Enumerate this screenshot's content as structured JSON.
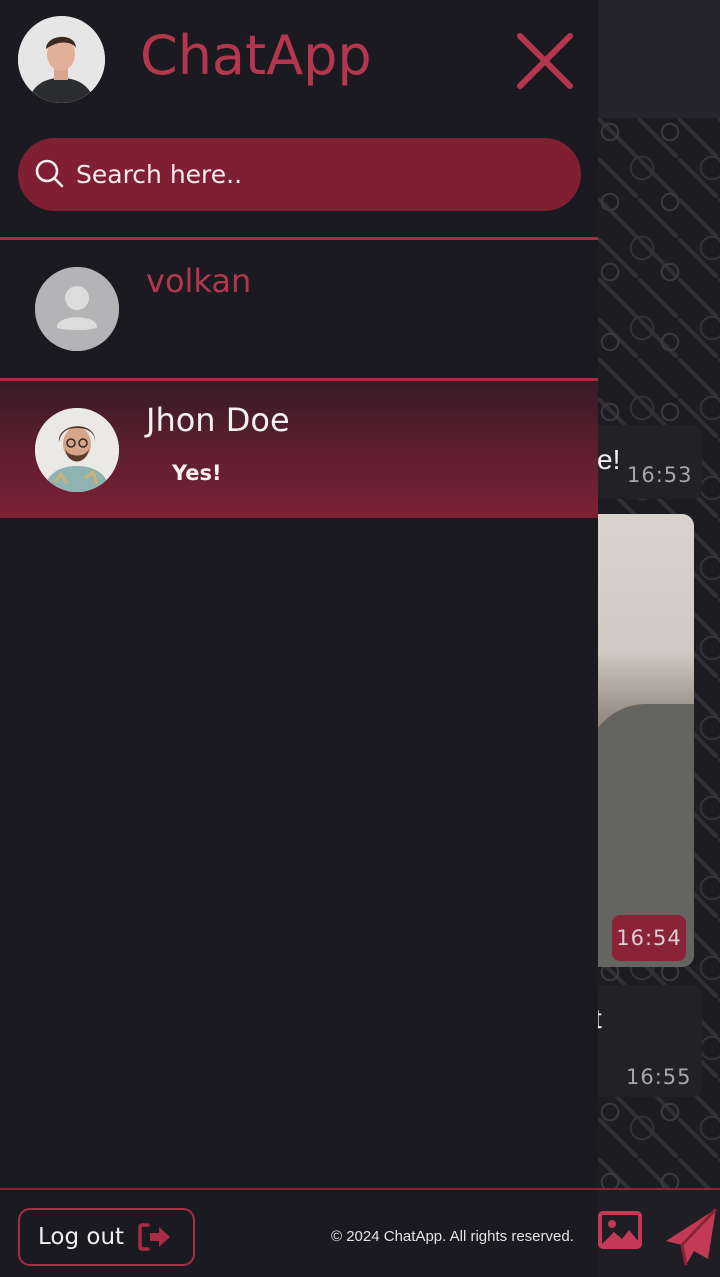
{
  "app": {
    "title": "ChatApp",
    "accent_color": "#b5374f",
    "dark_accent_color": "#801f31"
  },
  "header": {
    "close_icon": "close-icon",
    "avatar_icon": "user-avatar"
  },
  "search": {
    "placeholder": "Search here..",
    "icon": "search-icon"
  },
  "conversations": [
    {
      "name": "volkan",
      "last_message": "",
      "avatar": "default-avatar-icon",
      "active": false
    },
    {
      "name": "Jhon Doe",
      "last_message": "Yes!",
      "avatar": "user-photo",
      "active": true
    }
  ],
  "footer": {
    "logout_label": "Log out",
    "logout_icon": "logout-icon",
    "copyright": "© 2024 ChatApp. All rights reserved."
  },
  "background_chat": {
    "messages": [
      {
        "fragment": "e!",
        "time": "16:53"
      },
      {
        "fragment": "",
        "time": "16:54",
        "type": "image"
      },
      {
        "fragment": "t",
        "time": "16:55"
      }
    ],
    "composer": {
      "image_icon": "image-icon",
      "send_icon": "send-icon"
    }
  }
}
